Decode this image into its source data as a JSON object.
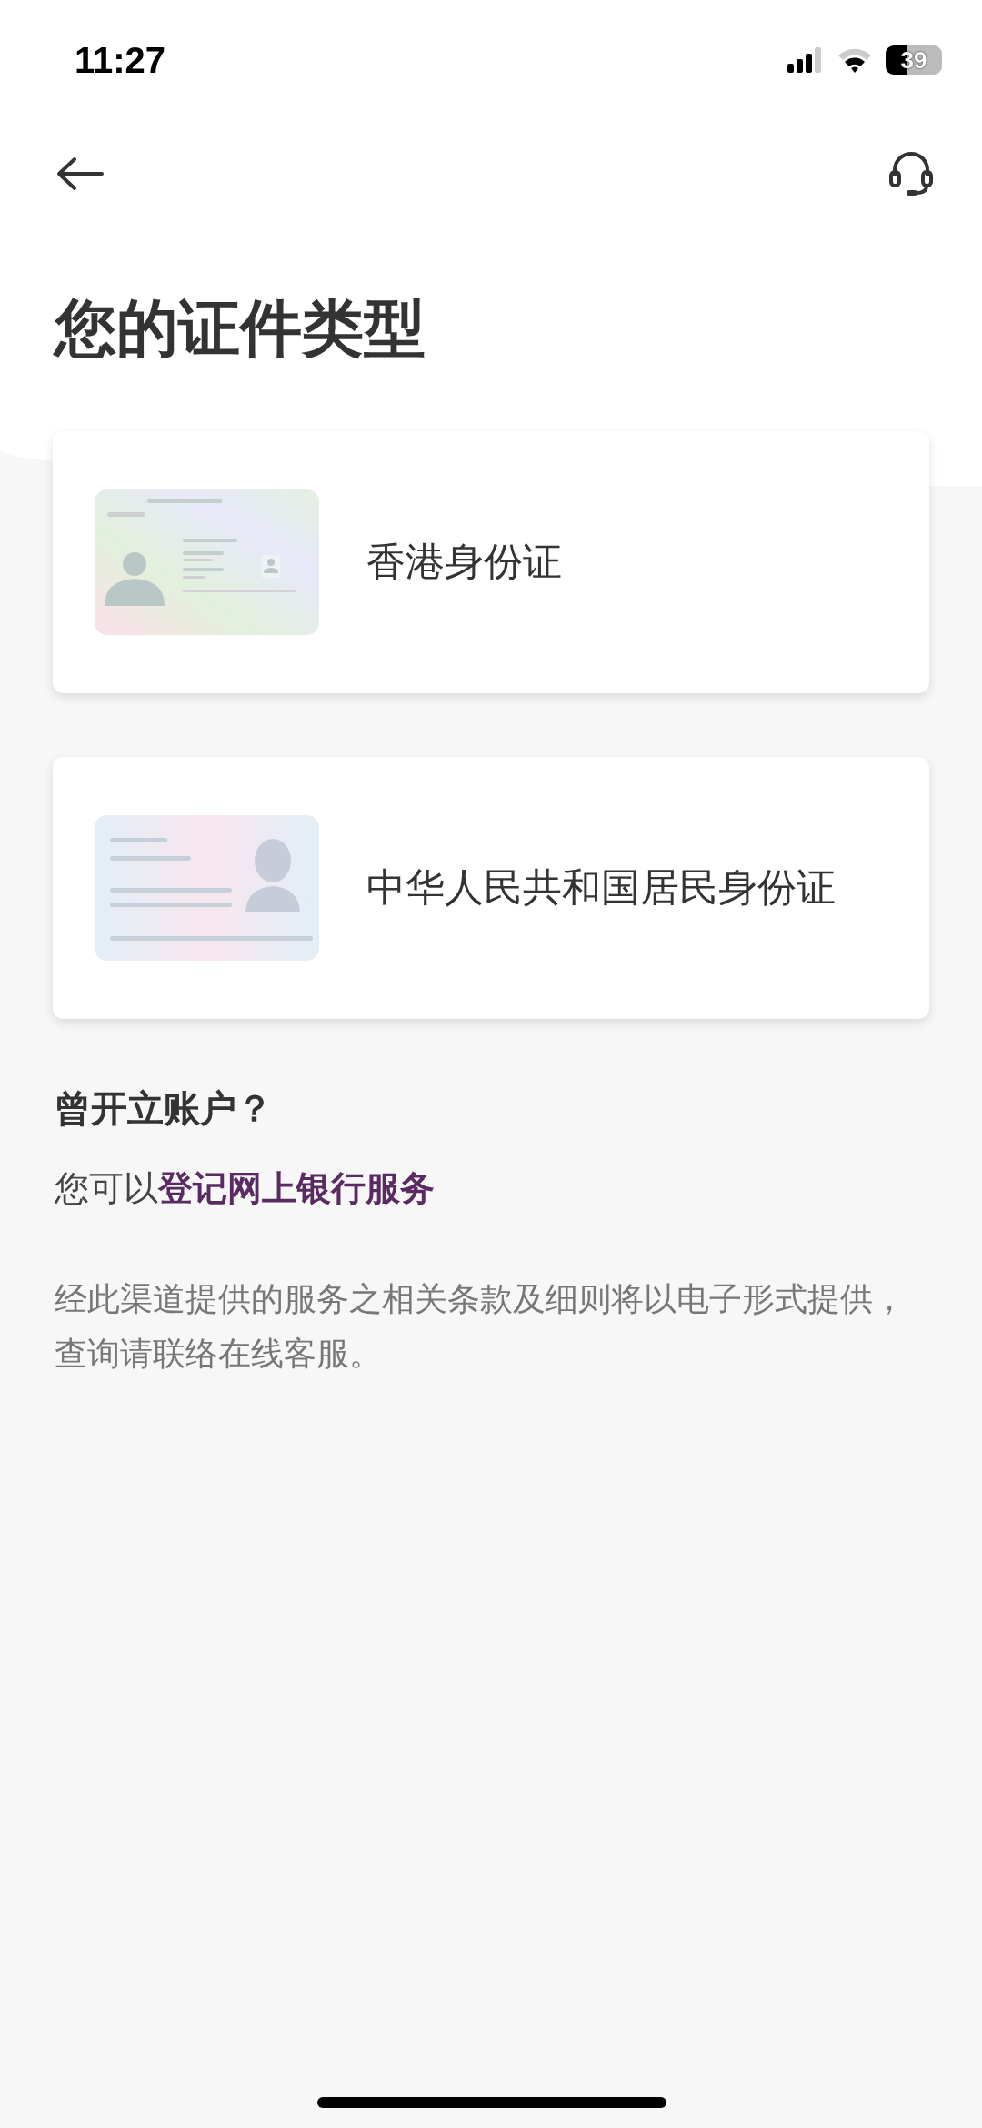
{
  "status_bar": {
    "time": "11:27",
    "battery": "39"
  },
  "title": "您的证件类型",
  "id_types": [
    {
      "kind": "hk",
      "label": "香港身份证"
    },
    {
      "kind": "mainland",
      "label": "中华人民共和国居民身份证"
    }
  ],
  "existing_account": {
    "heading": "曾开立账户？",
    "prefix": "您可以",
    "link": "登记网上银行服务"
  },
  "notice": "经此渠道提供的服务之相关条款及细则将以电子形式提供，查询请联络在线客服。"
}
